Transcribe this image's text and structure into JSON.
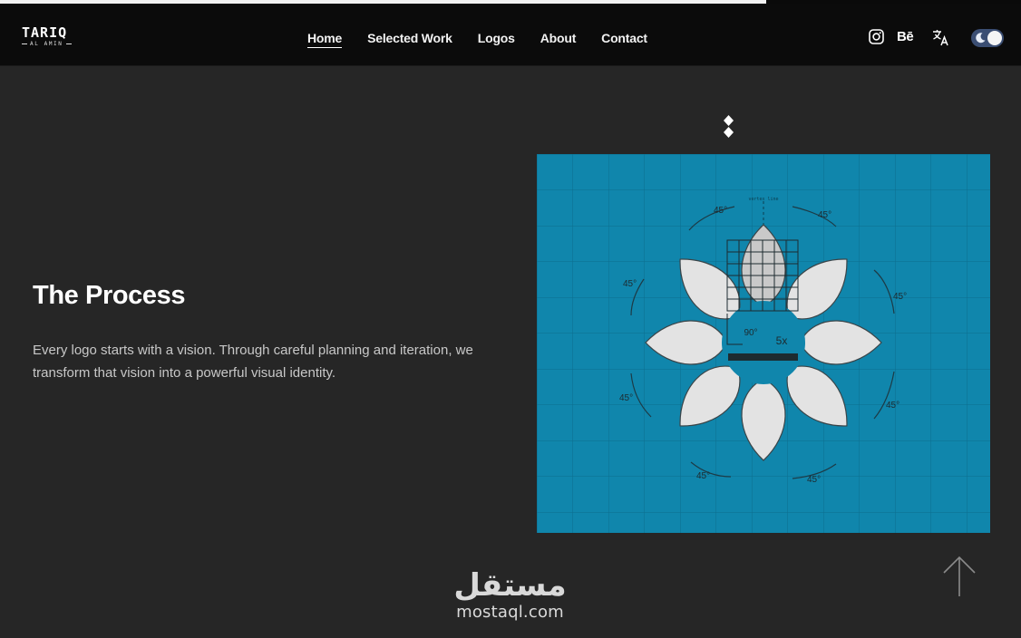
{
  "scroll_progress": 0.75,
  "colors": {
    "background": "#262626",
    "navbar": "#0b0b0b",
    "figure_blue": "#1086ac",
    "petal": "#e3e3e3",
    "toggle": "#3b4e73"
  },
  "brand": {
    "name": "TARIQ",
    "subtitle": "AL AMIN"
  },
  "nav": {
    "items": [
      {
        "label": "Home",
        "active": true
      },
      {
        "label": "Selected Work",
        "active": false
      },
      {
        "label": "Logos",
        "active": false
      },
      {
        "label": "About",
        "active": false
      },
      {
        "label": "Contact",
        "active": false
      }
    ]
  },
  "header_actions": {
    "instagram_icon": "instagram-icon",
    "behance_label": "Bē",
    "translate_icon": "translate-icon",
    "theme_toggle": "dark-mode"
  },
  "hero": {
    "title": "The Process",
    "description": "Every logo starts with a vision. Through careful planning and iteration, we transform that vision into a powerful visual identity."
  },
  "figure": {
    "top_label": "vertex line",
    "angle_labels": [
      "45°",
      "45°",
      "45°",
      "45°",
      "45°",
      "45°",
      "45°",
      "45°"
    ],
    "right_angle_label": "90°",
    "scale_label": "5x"
  },
  "scroll_top_icon": "arrow-up-icon",
  "watermark": {
    "arabic": "مستقل",
    "latin": "mostaql.com"
  }
}
